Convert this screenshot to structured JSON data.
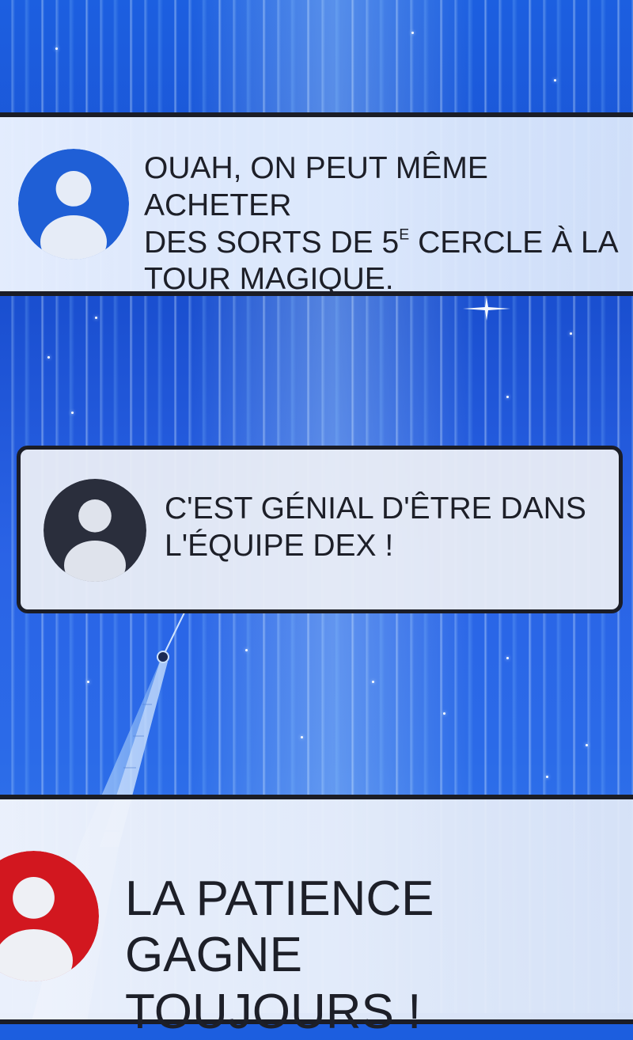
{
  "messages": [
    {
      "avatar_icon": "user-avatar-blue-icon",
      "avatar_color": "#1f5fd6",
      "line1": "OUAH, ON PEUT MÊME ACHETER",
      "line2_pre": "DES SORTS DE 5",
      "line2_sup": "E",
      "line2_post": " CERCLE À LA",
      "line3": "TOUR MAGIQUE."
    },
    {
      "avatar_icon": "user-avatar-dark-icon",
      "avatar_color": "#2a2e3c",
      "line1": "C'EST GÉNIAL D'ÊTRE DANS",
      "line2": "L'ÉQUIPE DEX !"
    },
    {
      "avatar_icon": "user-avatar-red-icon",
      "avatar_color": "#d2171f",
      "line1": "LA PATIENCE GAGNE",
      "line2": "TOUJOURS !"
    }
  ],
  "colors": {
    "background": "#1c5fe0",
    "panel": "#e6eefc",
    "border": "#1b1d26",
    "text": "#1d1f28"
  }
}
